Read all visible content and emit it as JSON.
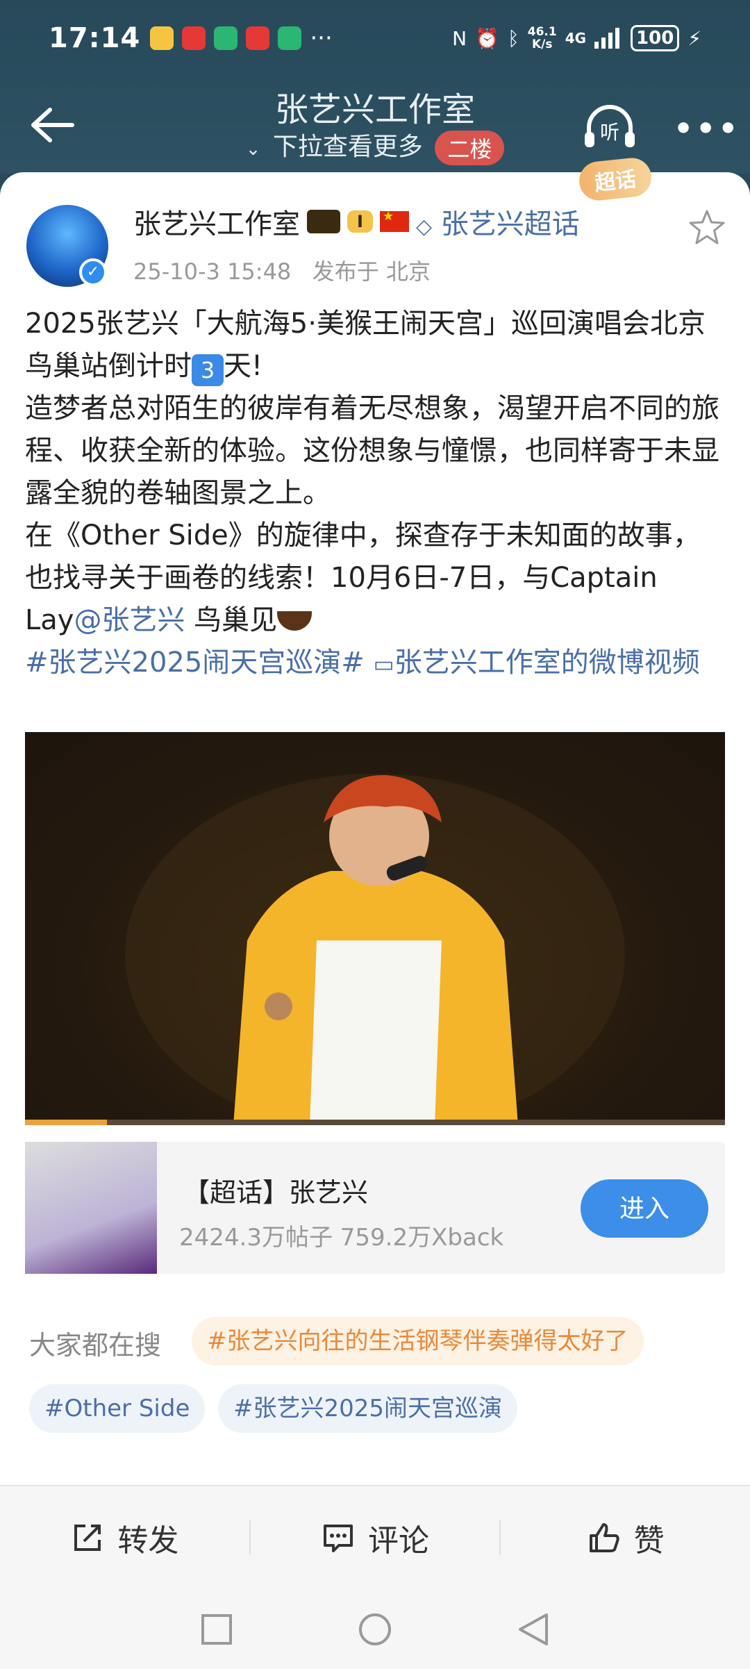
{
  "status_bar": {
    "time": "17:14",
    "net_speed_top": "46.1",
    "net_speed_bottom": "K/s",
    "signal": "4G",
    "battery": "100"
  },
  "header": {
    "title": "张艺兴工作室",
    "subtitle": "下拉查看更多",
    "floor_badge": "二楼",
    "listen_icon_label": "听",
    "chaohua_tag": "超话"
  },
  "post": {
    "author": "张艺兴工作室",
    "level": "I",
    "chaohua_link": "张艺兴超话",
    "date": "25-10-3 15:48",
    "location": "发布于 北京",
    "line1": "2025张艺兴「大航海5·美猴王闹天宫」巡回演唱会北京鸟巢站倒计时",
    "countdown": "3",
    "line1_end": "天!",
    "para2": "造梦者总对陌生的彼岸有着无尽想象，渴望开启不同的旅程、收获全新的体验。这份想象与憧憬，也同样寄于未显露全貌的卷轴图景之上。",
    "para3_start": "在《Other Side》的旋律中，探查存于未知面的故事，也找寻关于画卷的线索！10月6日-7日，与Captain Lay",
    "mention": "@张艺兴",
    "para3_end": " 鸟巢见",
    "hashtag": "#张艺兴2025闹天宫巡演#",
    "video_link": "张艺兴工作室的微博视频",
    "video_progress": 0.117
  },
  "super_topic_card": {
    "title": "【超话】张艺兴",
    "stats": "2424.3万帖子 759.2万Xback",
    "enter_label": "进入"
  },
  "search": {
    "label": "大家都在搜",
    "hot": "#张艺兴向往的生活钢琴伴奏弹得太好了",
    "tags": [
      "#Other Side",
      "#张艺兴2025闹天宫巡演"
    ]
  },
  "actions": {
    "repost": "转发",
    "comment": "评论",
    "like": "赞"
  },
  "colors": {
    "header_bg": "#2b4a58",
    "link": "#4a6fa5",
    "hot_chip": "#e8893a",
    "button": "#3d8ee9"
  }
}
